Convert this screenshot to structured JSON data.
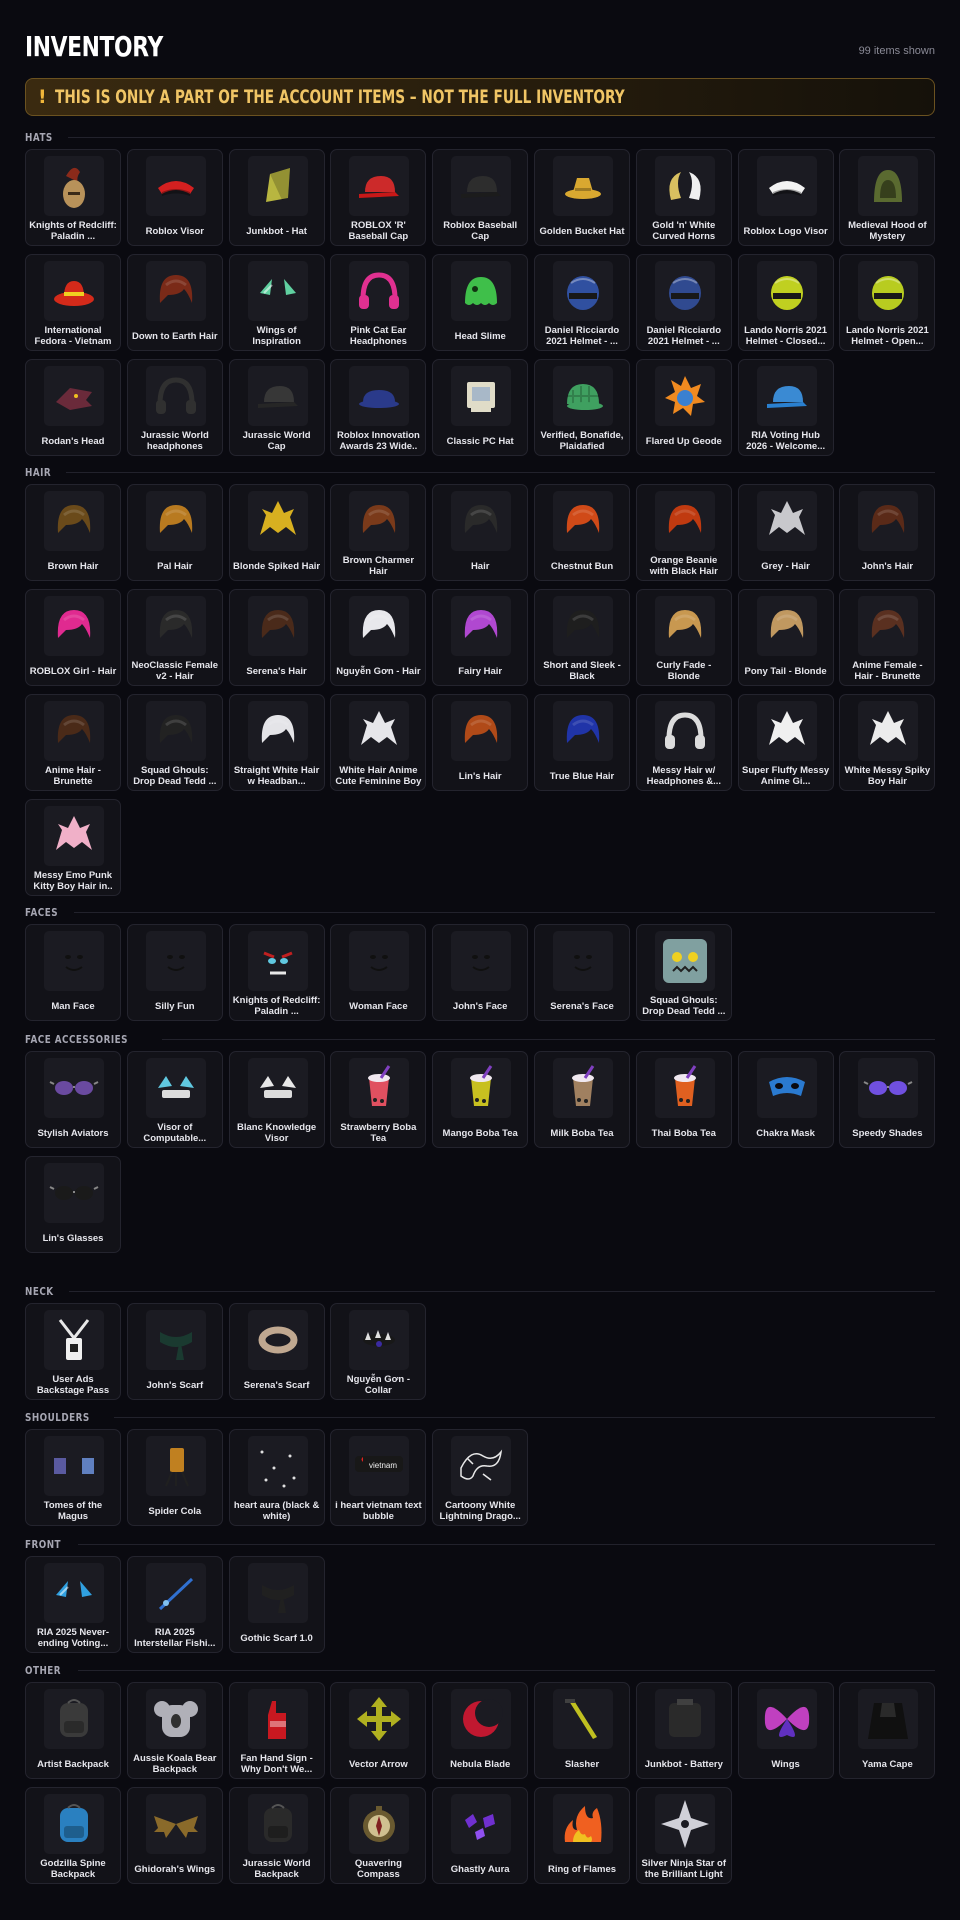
{
  "header": {
    "title": "INVENTORY",
    "count": "99 items shown"
  },
  "banner": {
    "icon": "!",
    "text": "THIS IS ONLY A PART OF THE ACCOUNT ITEMS – NOT THE FULL INVENTORY",
    "color": "#f0c565"
  },
  "sections": [
    {
      "name": "HATS",
      "items": [
        {
          "label": "Knights of Redcliff: Paladin ...",
          "icon": "helmet-plume",
          "color": "#8b2a1a"
        },
        {
          "label": "Roblox Visor",
          "icon": "visor",
          "color": "#d42020"
        },
        {
          "label": "Junkbot - Hat",
          "icon": "junk-hat",
          "color": "#b8b640"
        },
        {
          "label": "ROBLOX 'R' Baseball Cap",
          "icon": "cap",
          "color": "#c81818"
        },
        {
          "label": "Roblox Baseball Cap",
          "icon": "cap",
          "color": "#1c1c1c"
        },
        {
          "label": "Golden Bucket Hat",
          "icon": "bucket-hat",
          "color": "#d9a830"
        },
        {
          "label": "Gold 'n' White Curved Horns",
          "icon": "horns",
          "color": "#d8c060"
        },
        {
          "label": "Roblox Logo Visor",
          "icon": "visor",
          "color": "#f2f2f2"
        },
        {
          "label": "Medieval Hood of Mystery",
          "icon": "hood",
          "color": "#5a6a30"
        },
        {
          "label": "International Fedora - Vietnam",
          "icon": "fedora",
          "color": "#d42a1a"
        },
        {
          "label": "Down to Earth Hair",
          "icon": "hair",
          "color": "#7a2a18"
        },
        {
          "label": "Wings of Inspiration",
          "icon": "wings-small",
          "color": "#60d0a0"
        },
        {
          "label": "Pink Cat Ear Headphones",
          "icon": "headphones",
          "color": "#e03090"
        },
        {
          "label": "Head Slime",
          "icon": "slime",
          "color": "#3fbf4a"
        },
        {
          "label": "Daniel Ricciardo 2021 Helmet - ...",
          "icon": "helmet",
          "color": "#3050a0"
        },
        {
          "label": "Daniel Ricciardo 2021 Helmet - ...",
          "icon": "helmet",
          "color": "#304a90"
        },
        {
          "label": "Lando Norris 2021 Helmet - Closed...",
          "icon": "helmet",
          "color": "#c0d020"
        },
        {
          "label": "Lando Norris 2021 Helmet - Open...",
          "icon": "helmet",
          "color": "#b8cc20"
        },
        {
          "label": "Rodan's Head",
          "icon": "dragon-head",
          "color": "#6a2a3a"
        },
        {
          "label": "Jurassic World headphones",
          "icon": "headphones",
          "color": "#303030"
        },
        {
          "label": "Jurassic World Cap",
          "icon": "cap",
          "color": "#262626"
        },
        {
          "label": "Roblox Innovation Awards 23 Wide..",
          "icon": "wide-cap",
          "color": "#2a3a8a"
        },
        {
          "label": "Classic PC Hat",
          "icon": "pc",
          "color": "#e0dcc8"
        },
        {
          "label": "Verified, Bonafide, Plaidafied",
          "icon": "plaid-cap",
          "color": "#3fa060"
        },
        {
          "label": "Flared Up Geode",
          "icon": "geode",
          "color": "#f08a20"
        },
        {
          "label": "RIA Voting Hub 2026 - Welcome...",
          "icon": "cap",
          "color": "#2a80d0"
        }
      ]
    },
    {
      "name": "HAIR",
      "items": [
        {
          "label": "Brown Hair",
          "icon": "hair",
          "color": "#6a4a1a"
        },
        {
          "label": "Pal Hair",
          "icon": "hair",
          "color": "#b87a20"
        },
        {
          "label": "Blonde Spiked Hair",
          "icon": "spiky-hair",
          "color": "#d8b020"
        },
        {
          "label": "Brown Charmer Hair",
          "icon": "hair",
          "color": "#7a3a1a"
        },
        {
          "label": "Hair",
          "icon": "hair",
          "color": "#2a2a2a"
        },
        {
          "label": "Chestnut Bun",
          "icon": "hair",
          "color": "#d04a18"
        },
        {
          "label": "Orange Beanie with Black Hair",
          "icon": "hair",
          "color": "#c03a10"
        },
        {
          "label": "Grey - Hair",
          "icon": "spiky-hair",
          "color": "#c8c8cc"
        },
        {
          "label": "John's Hair",
          "icon": "hair",
          "color": "#5a2a18"
        },
        {
          "label": "ROBLOX Girl - Hair",
          "icon": "hair",
          "color": "#e02a90"
        },
        {
          "label": "NeoClassic Female v2 - Hair",
          "icon": "hair",
          "color": "#2a2a2a"
        },
        {
          "label": "Serena's Hair",
          "icon": "hair",
          "color": "#4a2a1a"
        },
        {
          "label": "Nguyễn Gơn - Hair",
          "icon": "hair",
          "color": "#e8e8ec"
        },
        {
          "label": "Fairy Hair",
          "icon": "hair",
          "color": "#b048d0"
        },
        {
          "label": "Short and Sleek - Black",
          "icon": "hair",
          "color": "#1e1e1e"
        },
        {
          "label": "Curly Fade - Blonde",
          "icon": "hair",
          "color": "#c89850"
        },
        {
          "label": "Pony Tail - Blonde",
          "icon": "hair",
          "color": "#c09860"
        },
        {
          "label": "Anime Female - Hair - Brunette",
          "icon": "hair",
          "color": "#5a3020"
        },
        {
          "label": "Anime Hair - Brunette",
          "icon": "hair",
          "color": "#4a2a18"
        },
        {
          "label": "Squad Ghouls: Drop Dead Tedd ...",
          "icon": "hair",
          "color": "#222222"
        },
        {
          "label": "Straight White Hair w Headban...",
          "icon": "hair",
          "color": "#e4e4e8"
        },
        {
          "label": "White Hair Anime Cute Feminine Boy",
          "icon": "spiky-hair",
          "color": "#e6e6ea"
        },
        {
          "label": "Lin's Hair",
          "icon": "hair",
          "color": "#b04a18"
        },
        {
          "label": "True Blue Hair",
          "icon": "hair",
          "color": "#2034a8"
        },
        {
          "label": "Messy Hair w/ Headphones &...",
          "icon": "headphones",
          "color": "#dcdcdc"
        },
        {
          "label": "Super Fluffy Messy Anime Gi...",
          "icon": "spiky-hair",
          "color": "#f0f0f0"
        },
        {
          "label": "White Messy Spiky Boy Hair",
          "icon": "spiky-hair",
          "color": "#ececec"
        },
        {
          "label": "Messy Emo Punk Kitty Boy Hair in..",
          "icon": "spiky-hair",
          "color": "#f0b0c8"
        }
      ]
    },
    {
      "name": "FACES",
      "items": [
        {
          "label": "Man Face",
          "icon": "face",
          "color": "#101010"
        },
        {
          "label": "Silly Fun",
          "icon": "face",
          "color": "#101010"
        },
        {
          "label": "Knights of Redcliff: Paladin ...",
          "icon": "face-angry",
          "color": "#c02020"
        },
        {
          "label": "Woman Face",
          "icon": "face",
          "color": "#101010"
        },
        {
          "label": "John's Face",
          "icon": "face",
          "color": "#101010"
        },
        {
          "label": "Serena's Face",
          "icon": "face",
          "color": "#101010"
        },
        {
          "label": "Squad Ghouls: Drop Dead Tedd ...",
          "icon": "zombie-face",
          "color": "#80a0a0"
        }
      ]
    },
    {
      "name": "FACE ACCESSORIES",
      "items": [
        {
          "label": "Stylish Aviators",
          "icon": "glasses",
          "color": "#6a4aa0"
        },
        {
          "label": "Visor of Computable...",
          "icon": "visor-tech",
          "color": "#60c8e0"
        },
        {
          "label": "Blanc Knowledge Visor",
          "icon": "visor-tech",
          "color": "#e8e8e8"
        },
        {
          "label": "Strawberry Boba Tea",
          "icon": "boba",
          "color": "#e05060"
        },
        {
          "label": "Mango Boba Tea",
          "icon": "boba",
          "color": "#c8c020"
        },
        {
          "label": "Milk Boba Tea",
          "icon": "boba",
          "color": "#a08060"
        },
        {
          "label": "Thai Boba Tea",
          "icon": "boba",
          "color": "#e06020"
        },
        {
          "label": "Chakra Mask",
          "icon": "mask",
          "color": "#2a7ad0"
        },
        {
          "label": "Speedy Shades",
          "icon": "glasses",
          "color": "#7050e0"
        },
        {
          "label": "Lin's Glasses",
          "icon": "glasses",
          "color": "#1a1a1a"
        }
      ]
    },
    {
      "name": "NECK",
      "items": [
        {
          "label": "User Ads Backstage Pass",
          "icon": "lanyard",
          "color": "#e8e8e8"
        },
        {
          "label": "John's Scarf",
          "icon": "scarf",
          "color": "#1a3a30"
        },
        {
          "label": "Serena's Scarf",
          "icon": "collar",
          "color": "#c0a890"
        },
        {
          "label": "Nguyễn Gơn - Collar",
          "icon": "collar-spike",
          "color": "#3a2aa0"
        }
      ]
    },
    {
      "name": "SHOULDERS",
      "items": [
        {
          "label": "Tomes of the Magus",
          "icon": "tomes",
          "color": "#5a5aa0"
        },
        {
          "label": "Spider Cola",
          "icon": "cola",
          "color": "#c08020"
        },
        {
          "label": "heart aura (black & white)",
          "icon": "aura",
          "color": "#e0e0e0"
        },
        {
          "label": "i heart vietnam text bubble",
          "icon": "text-bubble",
          "color": "#e02020"
        },
        {
          "label": "Cartoony White Lightning Drago...",
          "icon": "dragon-line",
          "color": "#e8e8e8"
        }
      ]
    },
    {
      "name": "FRONT",
      "items": [
        {
          "label": "RIA 2025 Never-ending Voting...",
          "icon": "wings-small",
          "color": "#30a0e0"
        },
        {
          "label": "RIA 2025 Interstellar Fishi...",
          "icon": "rod",
          "color": "#3070d0"
        },
        {
          "label": "Gothic Scarf 1.0",
          "icon": "scarf",
          "color": "#202020"
        }
      ]
    },
    {
      "name": "OTHER",
      "items": [
        {
          "label": "Artist Backpack",
          "icon": "backpack",
          "color": "#3a3a3a"
        },
        {
          "label": "Aussie Koala Bear Backpack",
          "icon": "koala",
          "color": "#b0b0b8"
        },
        {
          "label": "Fan Hand Sign - Why Don't We...",
          "icon": "foam-hand",
          "color": "#c81820"
        },
        {
          "label": "Vector Arrow",
          "icon": "arrows",
          "color": "#b0b020"
        },
        {
          "label": "Nebula Blade",
          "icon": "crescent",
          "color": "#c01830"
        },
        {
          "label": "Slasher",
          "icon": "blade",
          "color": "#c0c020"
        },
        {
          "label": "Junkbot - Battery",
          "icon": "battery",
          "color": "#2a2a2a"
        },
        {
          "label": "Wings",
          "icon": "butterfly",
          "color": "#c040c0"
        },
        {
          "label": "Yama Cape",
          "icon": "cape",
          "color": "#141414"
        },
        {
          "label": "Godzilla Spine Backpack",
          "icon": "backpack",
          "color": "#2a80c0"
        },
        {
          "label": "Ghidorah's Wings",
          "icon": "bat-wings",
          "color": "#8a6a2a"
        },
        {
          "label": "Jurassic World Backpack",
          "icon": "backpack",
          "color": "#2a2a2a"
        },
        {
          "label": "Quavering Compass",
          "icon": "compass",
          "color": "#6a5a30"
        },
        {
          "label": "Ghastly Aura",
          "icon": "aura-purple",
          "color": "#7030d0"
        },
        {
          "label": "Ring of Flames",
          "icon": "flames",
          "color": "#f06020"
        },
        {
          "label": "Silver Ninja Star of the Brilliant Light",
          "icon": "ninja-star",
          "color": "#d0d0d8"
        }
      ]
    }
  ]
}
